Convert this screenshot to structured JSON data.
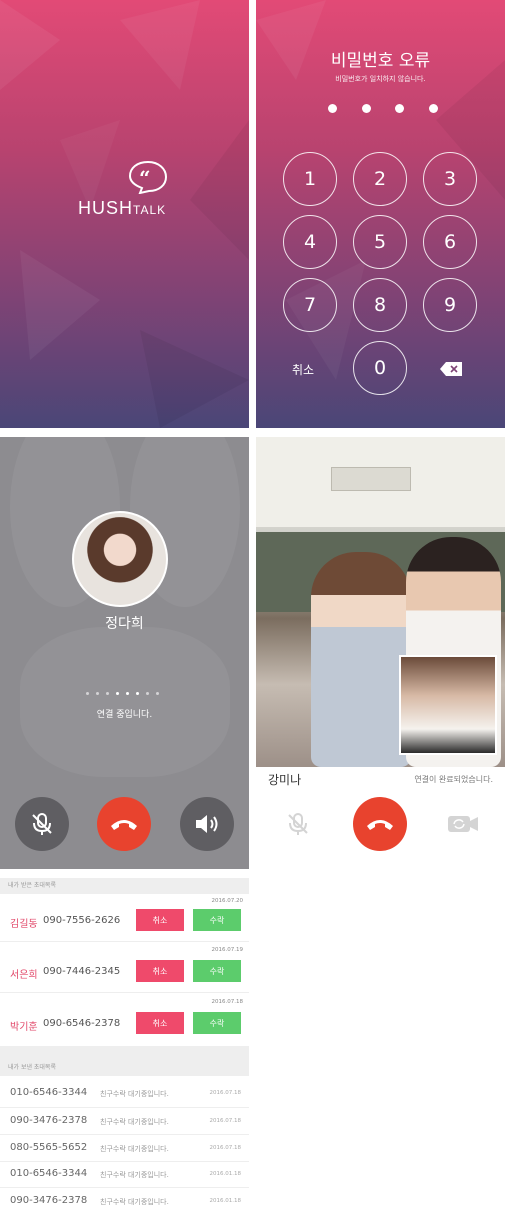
{
  "splash": {
    "brand_hush": "HUSH",
    "brand_talk": "TALK",
    "logo_icon": "quote-bubble-icon"
  },
  "pin": {
    "title": "비밀번호 오류",
    "subtitle": "비밀번호가 일치하지 않습니다.",
    "dots_filled": 4,
    "keys": [
      "1",
      "2",
      "3",
      "4",
      "5",
      "6",
      "7",
      "8",
      "9"
    ],
    "zero_key": "0",
    "cancel_label": "취소",
    "delete_icon": "backspace-icon"
  },
  "call": {
    "contact_name": "정다희",
    "status": "연결 중입니다.",
    "icons": [
      "mic-off-icon",
      "hang-up-icon",
      "speaker-icon"
    ],
    "colors": {
      "hangup": "#e8432e",
      "button_bg": "#5f5e62"
    }
  },
  "video": {
    "contact_name": "강미나",
    "status": "연결이 완료되었습니다.",
    "icons": [
      "mic-off-icon",
      "hang-up-icon",
      "switch-camera-icon"
    ]
  },
  "invites": {
    "received_header": "내가 받은 초대목록",
    "received": [
      {
        "date": "2016.07.20",
        "name": "김길동",
        "phone": "090-7556-2626",
        "cancel": "취소",
        "accept": "수락"
      },
      {
        "date": "2016.07.19",
        "name": "서은희",
        "phone": "090-7446-2345",
        "cancel": "취소",
        "accept": "수락"
      },
      {
        "date": "2016.07.18",
        "name": "박기훈",
        "phone": "090-6546-2378",
        "cancel": "취소",
        "accept": "수락"
      }
    ],
    "sent_header": "내가 보낸 초대목록",
    "sent": [
      {
        "phone": "010-6546-3344",
        "status": "친구수락 대기중입니다.",
        "date": "2016.07.18"
      },
      {
        "phone": "090-3476-2378",
        "status": "친구수락 대기중입니다.",
        "date": "2016.07.18"
      },
      {
        "phone": "080-5565-5652",
        "status": "친구수락 대기중입니다.",
        "date": "2016.07.18"
      },
      {
        "phone": "010-6546-3344",
        "status": "친구수락 대기중입니다.",
        "date": "2016.01.18"
      },
      {
        "phone": "090-3476-2378",
        "status": "친구수락 대기중입니다.",
        "date": "2016.01.18"
      }
    ],
    "colors": {
      "cancel": "#ef4a6b",
      "accept": "#5ccc6c",
      "name": "#e24a6b"
    }
  }
}
